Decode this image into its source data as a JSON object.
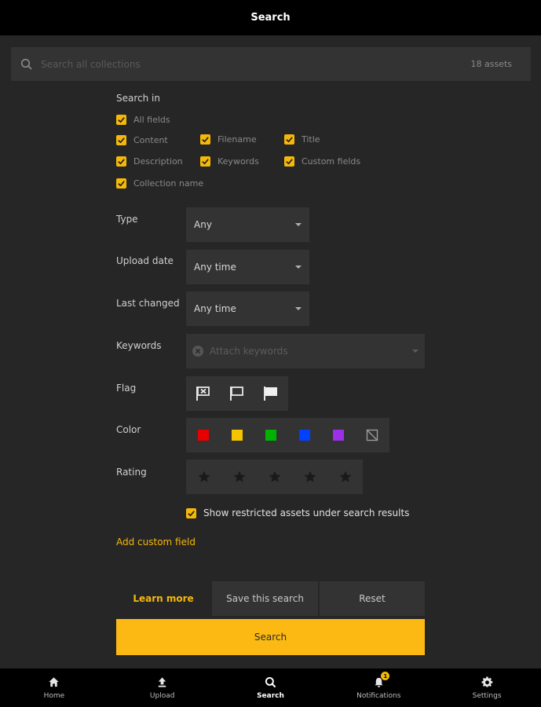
{
  "header": {
    "title": "Search"
  },
  "search": {
    "placeholder": "Search all collections",
    "count": "18 assets"
  },
  "search_in": {
    "label": "Search in",
    "options": [
      {
        "label": "All fields",
        "checked": true
      },
      {
        "label": "Content",
        "checked": true
      },
      {
        "label": "Filename",
        "checked": true
      },
      {
        "label": "Title",
        "checked": true
      },
      {
        "label": "Description",
        "checked": true
      },
      {
        "label": "Keywords",
        "checked": true
      },
      {
        "label": "Custom fields",
        "checked": true
      },
      {
        "label": "Collection name",
        "checked": true
      }
    ]
  },
  "filters": {
    "type": {
      "label": "Type",
      "value": "Any"
    },
    "upload_date": {
      "label": "Upload date",
      "value": "Any time"
    },
    "last_changed": {
      "label": "Last changed",
      "value": "Any time"
    },
    "keywords": {
      "label": "Keywords",
      "placeholder": "Attach keywords"
    },
    "flag": {
      "label": "Flag",
      "icons": [
        "flag-rejected-icon",
        "flag-outline-icon",
        "flag-filled-icon"
      ]
    },
    "color": {
      "label": "Color",
      "swatches": [
        "#e60000",
        "#f5c400",
        "#00b300",
        "#0040ff",
        "#9b30e6"
      ],
      "none_icon": "no-color-icon"
    },
    "rating": {
      "label": "Rating",
      "stars": 5
    }
  },
  "restricted": {
    "label": "Show restricted assets under search results",
    "checked": true
  },
  "add_custom_field": "Add custom field",
  "actions": {
    "learn_more": "Learn more",
    "save_search": "Save this search",
    "reset": "Reset",
    "search": "Search"
  },
  "nav": [
    {
      "label": "Home",
      "icon": "home-icon"
    },
    {
      "label": "Upload",
      "icon": "upload-icon"
    },
    {
      "label": "Search",
      "icon": "search-icon",
      "active": true
    },
    {
      "label": "Notifications",
      "icon": "bell-icon",
      "badge": "1"
    },
    {
      "label": "Settings",
      "icon": "gear-icon"
    }
  ],
  "colors": {
    "accent": "#f5b80a",
    "background": "#262626",
    "panel": "#333333"
  }
}
